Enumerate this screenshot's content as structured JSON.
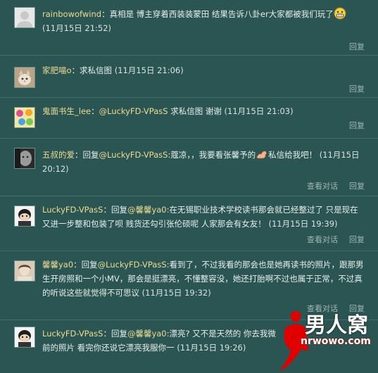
{
  "comments": [
    {
      "user": "rainbowofwind",
      "sep": "：",
      "text": "真相是 博主穿着西装装蒙田 结果告诉八卦er大家都被我们玩了",
      "time": "(11月15日 21:52)",
      "reply": "回复"
    },
    {
      "user": "家肥喵o",
      "sep": "：",
      "text": "求私信图",
      "time": "(11月15日 21:06)",
      "reply": "回复"
    },
    {
      "user": "鬼面书生_lee",
      "sep": "：",
      "mention": "@LuckyFD-VPasS",
      "text": " 求私信图 谢谢",
      "time": "(11月15日 21:03)",
      "reply": "回复"
    },
    {
      "user": "五叔的爱",
      "prefix": "：回复",
      "mention": "@LuckyFD-VPasS",
      "text": ":蔻凉，，我要看张馨予的",
      "text2": "私信给我吧！",
      "time": "(11月15日 20:12)",
      "view": "查看对话",
      "reply": "回复"
    },
    {
      "user": "LuckyFD-VPasS",
      "prefix": "：回复",
      "mention": "@馨馨ya0",
      "text": ":在无锡职业技术学校读书那会就已经整过了 只是现在又进一步整和包装了呗 贱货还勾引张伦硕呢 人家那会有女友！",
      "time": "(11月15日 19:39)",
      "view": "查看对话",
      "reply": "回复"
    },
    {
      "user": "馨馨ya0",
      "prefix": "：回复",
      "mention": "@LuckyFD-VPasS",
      "text": ":看到了，不过我看的那会也是她再读书的照片，跟那男生开房照和一个小MV，那会是挺漂亮，不懂整容没，她还打胎啊不过也属于正常，不过真的听说这些就觉得不可思议",
      "time": "(11月15日 19:32)",
      "view": "查看对话",
      "reply": "回复"
    },
    {
      "user": "LuckyFD-VPasS",
      "prefix": "：回复",
      "mention": "@馨馨ya0",
      "text": ":漂亮? 又不是天然的 你去我微",
      "text2": "前的照片 看完你还说它漂亮我服你一",
      "time": "(11月15日 19:26)"
    }
  ],
  "logo": {
    "title": "男人窝",
    "url": "nrwowo.com"
  },
  "colors": {
    "background": "#2b5552",
    "username": "#eddc93",
    "text": "#e6eeec",
    "action": "#9fb6b3"
  }
}
